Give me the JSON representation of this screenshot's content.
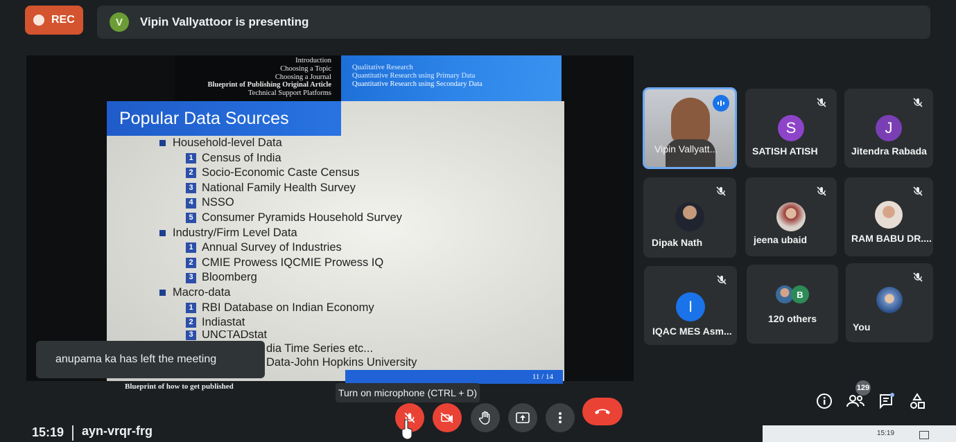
{
  "top_bar": {
    "rec_label": "REC",
    "presenter_initial": "V",
    "presenting_text": "Vipin Vallyattoor is presenting"
  },
  "slide": {
    "nav_sections": [
      "Introduction",
      "Choosing a Topic",
      "Choosing a Journal",
      "Blueprint of Publishing Original Article",
      "Technical Support Platforms"
    ],
    "nav_subsections": [
      "Qualitative Research",
      "Quantitative Research using Primary Data",
      "Quantitative Research using Secondary Data"
    ],
    "title": "Popular Data Sources",
    "cat1": "Household-level Data",
    "cat1_items": [
      "Census of India",
      "Socio-Economic Caste Census",
      "National Family Health Survey",
      "NSSO",
      "Consumer Pyramids Household Survey"
    ],
    "cat2": "Industry/Firm Level Data",
    "cat2_items": [
      "Annual Survey of Industries",
      "CMIE Prowess IQCMIE Prowess IQ",
      "Bloomberg"
    ],
    "cat3": "Macro-data",
    "cat3_items": [
      "RBI Database on Indian Economy",
      "Indiastat",
      "UNCTADstat",
      "dia Time Series etc...",
      "Data-John Hopkins University"
    ],
    "page_number": "11 / 14",
    "footer": "Blueprint of how to get published"
  },
  "toast": "anupama ka has left the meeting",
  "tooltip": "Turn on microphone (CTRL + D)",
  "participants": {
    "presenter_name": "Vipin Vallyatt...",
    "satish": {
      "initial": "S",
      "name": "SATISH ATISH",
      "color": "#8e44c9"
    },
    "jitendra": {
      "initial": "J",
      "name": "Jitendra Rabada",
      "color": "#7b3fb5"
    },
    "dipak": {
      "name": "Dipak Nath"
    },
    "jeena": {
      "name": "jeena ubaid"
    },
    "rambabu": {
      "name": "RAM BABU DR...."
    },
    "iqac": {
      "initial": "I",
      "name": "IQAC MES Asm...",
      "color": "#1a73e8"
    },
    "others": {
      "label": "120 others",
      "initial": "B"
    },
    "you": {
      "name": "You"
    }
  },
  "bottom": {
    "time": "15:19",
    "meeting_code": "ayn-vrqr-frg",
    "people_count": "129",
    "system_time": "15:19"
  },
  "icons": [
    "mic-off-icon",
    "camera-off-icon",
    "raise-hand-icon",
    "present-screen-icon",
    "more-options-icon",
    "end-call-icon",
    "info-icon",
    "people-icon",
    "chat-icon",
    "activities-icon"
  ]
}
